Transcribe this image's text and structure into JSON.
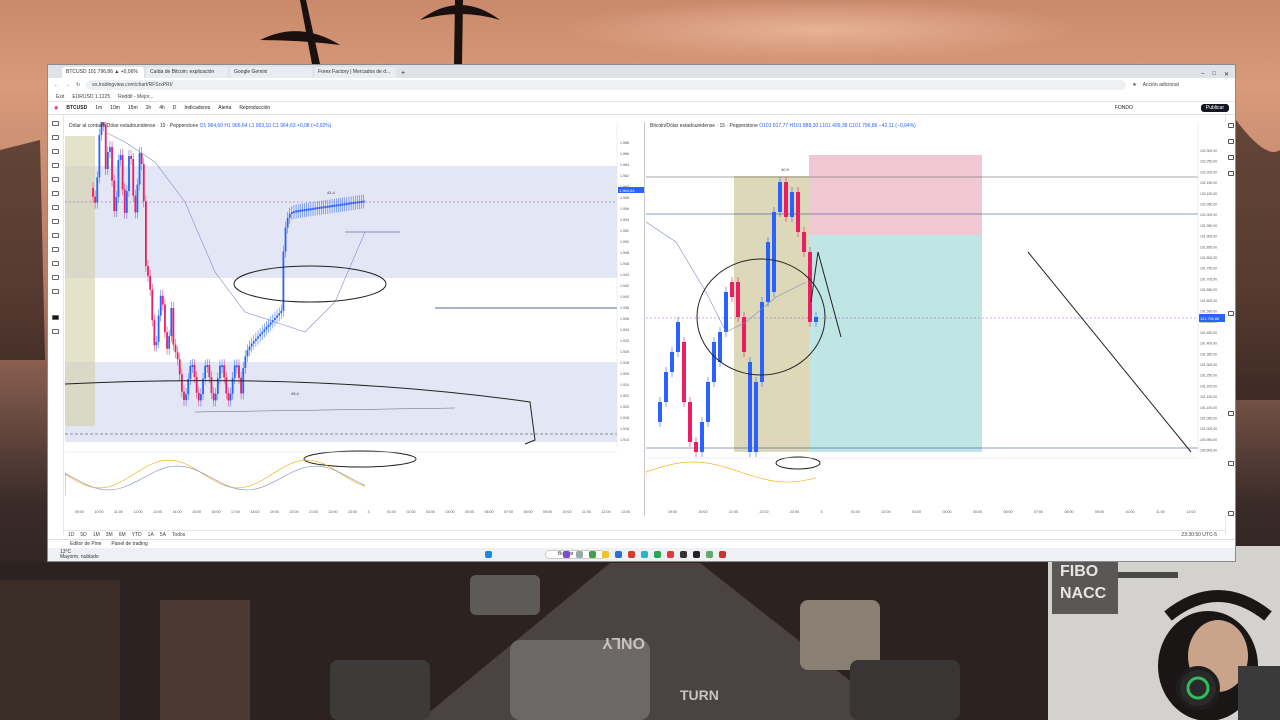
{
  "browser": {
    "tabs": [
      {
        "label": "BTCUSD 101 796,86 ▲ +0,06%",
        "active": true
      },
      {
        "label": "Caída de Bitcoin: explicación",
        "active": false
      },
      {
        "label": "Google Gemini",
        "active": false
      },
      {
        "label": "Forex Factory | Mercados de d...",
        "active": false
      }
    ],
    "url": "es.tradingview.com/chart/RFSrxPRI/",
    "profile": "Acción adicional",
    "bookmarks": [
      "Exit",
      "EURUSD 1.1225",
      "Reddit - Mejor..."
    ]
  },
  "tv_toolbar": {
    "symbol": "BTCUSD",
    "intervals": [
      "1m",
      "10m",
      "15m",
      "1h",
      "4h",
      "D",
      "1m"
    ],
    "indicators_label": "Indicadores",
    "alert_label": "Alerta",
    "replay_label": "Reproducción",
    "layout_label": "FONDO",
    "publish_label": "Publicar"
  },
  "left_chart": {
    "title": "Dólar al contado/Dólar estadounidense · 10 · Pepperstone",
    "ohlc": "O1 964,60 H1 966,64 L1 963,10 C1 964,63 +0,08 (+0,02%)",
    "price_ticks": [
      "1.968",
      "1.966",
      "1.964",
      "1.962",
      "1.960",
      "1.958",
      "1.956",
      "1.954",
      "1.952",
      "1.950",
      "1.948",
      "1.946",
      "1.944",
      "1.942",
      "1.940",
      "1.938",
      "1.936",
      "1.934",
      "1.932",
      "1.930",
      "1.928",
      "1.926",
      "1.924",
      "1.922",
      "1.920",
      "1.918",
      "1.916",
      "1.914"
    ],
    "time_ticks": [
      "09:00",
      "10:00",
      "11:00",
      "12:00",
      "13:00",
      "14:00",
      "15:00",
      "16:00",
      "17:00",
      "18:00",
      "19:00",
      "20:00",
      "21:00",
      "22:00",
      "23:00",
      "3",
      "01:00",
      "02:00",
      "03:00",
      "04:00",
      "05:00",
      "06:00",
      "07:00",
      "08:00",
      "09:00",
      "10:00",
      "11:00",
      "12:00",
      "13:00"
    ],
    "price_label": "1.964,64",
    "high_label": "41.4",
    "low_label": "45.4"
  },
  "right_chart": {
    "title": "Bitcoin/Dólar estadounidense · 15 · Pepperstone",
    "ohlc": "O101 817,77 H101 888,20 L101 499,38 C101 796,86 −42,11 (−0,04%)",
    "price_ticks": [
      "102.300,00",
      "102.250,00",
      "102.200,00",
      "102.150,00",
      "102.100,00",
      "102.050,00",
      "102.000,00",
      "101.950,00",
      "101.900,00",
      "101.850,00",
      "101.800,00",
      "101.750,00",
      "101.700,00",
      "101.650,00",
      "101.600,00",
      "101.550,00",
      "101.500,00",
      "101.450,00",
      "101.400,00",
      "101.350,00",
      "101.300,00",
      "101.250,00",
      "101.200,00",
      "101.150,00",
      "101.100,00",
      "101.050,00",
      "101.000,00",
      "100.950,00",
      "100.900,00"
    ],
    "time_ticks": [
      "19:00",
      "20:00",
      "21:00",
      "22:00",
      "23:00",
      "5",
      "01:00",
      "02:00",
      "03:00",
      "04:00",
      "05:00",
      "06:00",
      "07:00",
      "08:00",
      "09:00",
      "10:00",
      "11:00",
      "12:00"
    ],
    "price_label": "101.796,86",
    "high_label": "40.9",
    "clock": "23:30:50 UTC-5"
  },
  "bottom_bar": {
    "ranges": [
      "1D",
      "5D",
      "1M",
      "3M",
      "6M",
      "YTD",
      "1A",
      "5A",
      "Todos"
    ],
    "tabs": [
      "Editor de Pine",
      "Panel de trading"
    ]
  },
  "taskbar": {
    "weather_temp": "13°C",
    "weather_text": "Mayorm. nublado",
    "search_placeholder": "Buscar"
  },
  "webcam": {
    "sign_text": "FIBO\nNACC"
  },
  "colors": {
    "bull": "#2962ff",
    "bear": "#e91e63",
    "tp_zone": "#bfe6e4",
    "sl_zone": "#f0c8d4",
    "band": "#e3e6f5",
    "olive": "#d4cfa6"
  }
}
